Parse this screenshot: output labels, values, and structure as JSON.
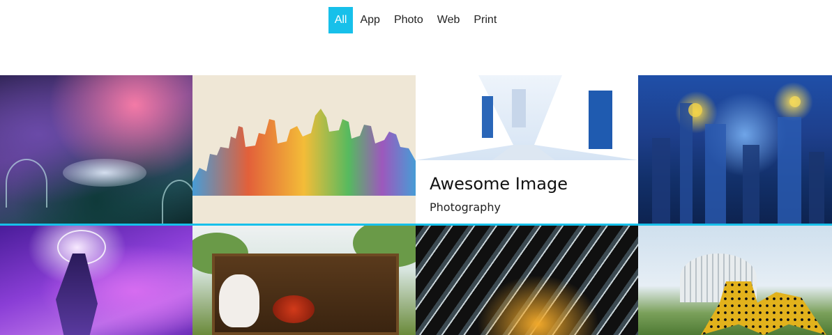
{
  "filters": {
    "items": [
      {
        "label": "All",
        "active": true
      },
      {
        "label": "App",
        "active": false
      },
      {
        "label": "Photo",
        "active": false
      },
      {
        "label": "Web",
        "active": false
      },
      {
        "label": "Print",
        "active": false
      }
    ]
  },
  "colors": {
    "accent": "#17c0ea"
  },
  "gallery": {
    "hover_item": {
      "title": "Awesome Image",
      "category": "Photography"
    }
  }
}
